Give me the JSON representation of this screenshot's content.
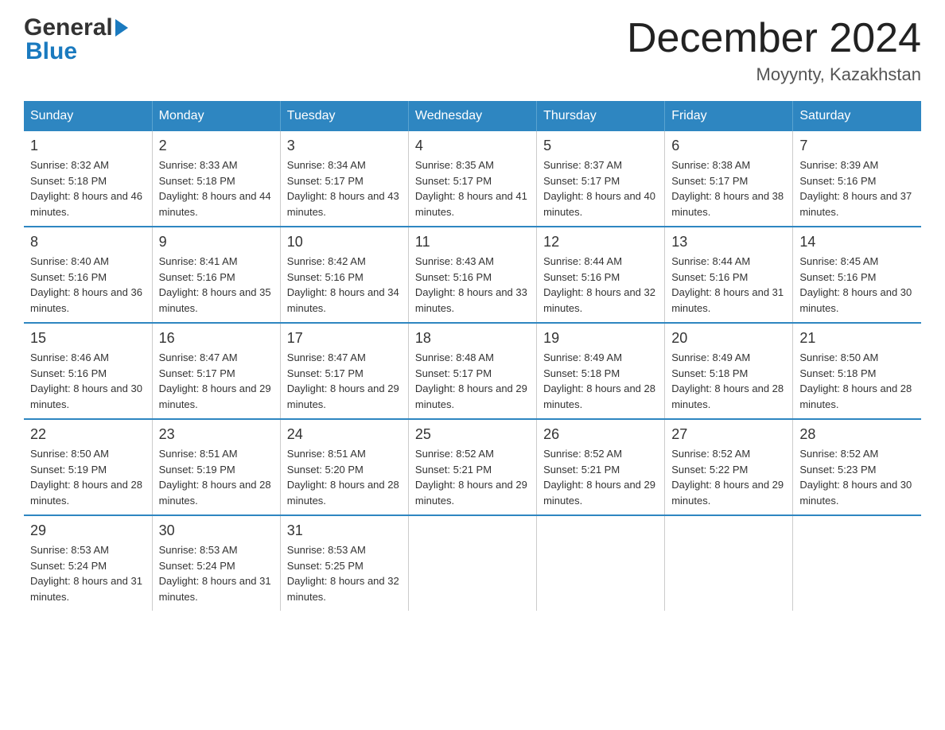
{
  "logo": {
    "text_general": "General",
    "text_blue": "Blue"
  },
  "header": {
    "month_title": "December 2024",
    "location": "Moyynty, Kazakhstan"
  },
  "days_of_week": [
    "Sunday",
    "Monday",
    "Tuesday",
    "Wednesday",
    "Thursday",
    "Friday",
    "Saturday"
  ],
  "weeks": [
    [
      {
        "day": "1",
        "sunrise": "Sunrise: 8:32 AM",
        "sunset": "Sunset: 5:18 PM",
        "daylight": "Daylight: 8 hours and 46 minutes."
      },
      {
        "day": "2",
        "sunrise": "Sunrise: 8:33 AM",
        "sunset": "Sunset: 5:18 PM",
        "daylight": "Daylight: 8 hours and 44 minutes."
      },
      {
        "day": "3",
        "sunrise": "Sunrise: 8:34 AM",
        "sunset": "Sunset: 5:17 PM",
        "daylight": "Daylight: 8 hours and 43 minutes."
      },
      {
        "day": "4",
        "sunrise": "Sunrise: 8:35 AM",
        "sunset": "Sunset: 5:17 PM",
        "daylight": "Daylight: 8 hours and 41 minutes."
      },
      {
        "day": "5",
        "sunrise": "Sunrise: 8:37 AM",
        "sunset": "Sunset: 5:17 PM",
        "daylight": "Daylight: 8 hours and 40 minutes."
      },
      {
        "day": "6",
        "sunrise": "Sunrise: 8:38 AM",
        "sunset": "Sunset: 5:17 PM",
        "daylight": "Daylight: 8 hours and 38 minutes."
      },
      {
        "day": "7",
        "sunrise": "Sunrise: 8:39 AM",
        "sunset": "Sunset: 5:16 PM",
        "daylight": "Daylight: 8 hours and 37 minutes."
      }
    ],
    [
      {
        "day": "8",
        "sunrise": "Sunrise: 8:40 AM",
        "sunset": "Sunset: 5:16 PM",
        "daylight": "Daylight: 8 hours and 36 minutes."
      },
      {
        "day": "9",
        "sunrise": "Sunrise: 8:41 AM",
        "sunset": "Sunset: 5:16 PM",
        "daylight": "Daylight: 8 hours and 35 minutes."
      },
      {
        "day": "10",
        "sunrise": "Sunrise: 8:42 AM",
        "sunset": "Sunset: 5:16 PM",
        "daylight": "Daylight: 8 hours and 34 minutes."
      },
      {
        "day": "11",
        "sunrise": "Sunrise: 8:43 AM",
        "sunset": "Sunset: 5:16 PM",
        "daylight": "Daylight: 8 hours and 33 minutes."
      },
      {
        "day": "12",
        "sunrise": "Sunrise: 8:44 AM",
        "sunset": "Sunset: 5:16 PM",
        "daylight": "Daylight: 8 hours and 32 minutes."
      },
      {
        "day": "13",
        "sunrise": "Sunrise: 8:44 AM",
        "sunset": "Sunset: 5:16 PM",
        "daylight": "Daylight: 8 hours and 31 minutes."
      },
      {
        "day": "14",
        "sunrise": "Sunrise: 8:45 AM",
        "sunset": "Sunset: 5:16 PM",
        "daylight": "Daylight: 8 hours and 30 minutes."
      }
    ],
    [
      {
        "day": "15",
        "sunrise": "Sunrise: 8:46 AM",
        "sunset": "Sunset: 5:16 PM",
        "daylight": "Daylight: 8 hours and 30 minutes."
      },
      {
        "day": "16",
        "sunrise": "Sunrise: 8:47 AM",
        "sunset": "Sunset: 5:17 PM",
        "daylight": "Daylight: 8 hours and 29 minutes."
      },
      {
        "day": "17",
        "sunrise": "Sunrise: 8:47 AM",
        "sunset": "Sunset: 5:17 PM",
        "daylight": "Daylight: 8 hours and 29 minutes."
      },
      {
        "day": "18",
        "sunrise": "Sunrise: 8:48 AM",
        "sunset": "Sunset: 5:17 PM",
        "daylight": "Daylight: 8 hours and 29 minutes."
      },
      {
        "day": "19",
        "sunrise": "Sunrise: 8:49 AM",
        "sunset": "Sunset: 5:18 PM",
        "daylight": "Daylight: 8 hours and 28 minutes."
      },
      {
        "day": "20",
        "sunrise": "Sunrise: 8:49 AM",
        "sunset": "Sunset: 5:18 PM",
        "daylight": "Daylight: 8 hours and 28 minutes."
      },
      {
        "day": "21",
        "sunrise": "Sunrise: 8:50 AM",
        "sunset": "Sunset: 5:18 PM",
        "daylight": "Daylight: 8 hours and 28 minutes."
      }
    ],
    [
      {
        "day": "22",
        "sunrise": "Sunrise: 8:50 AM",
        "sunset": "Sunset: 5:19 PM",
        "daylight": "Daylight: 8 hours and 28 minutes."
      },
      {
        "day": "23",
        "sunrise": "Sunrise: 8:51 AM",
        "sunset": "Sunset: 5:19 PM",
        "daylight": "Daylight: 8 hours and 28 minutes."
      },
      {
        "day": "24",
        "sunrise": "Sunrise: 8:51 AM",
        "sunset": "Sunset: 5:20 PM",
        "daylight": "Daylight: 8 hours and 28 minutes."
      },
      {
        "day": "25",
        "sunrise": "Sunrise: 8:52 AM",
        "sunset": "Sunset: 5:21 PM",
        "daylight": "Daylight: 8 hours and 29 minutes."
      },
      {
        "day": "26",
        "sunrise": "Sunrise: 8:52 AM",
        "sunset": "Sunset: 5:21 PM",
        "daylight": "Daylight: 8 hours and 29 minutes."
      },
      {
        "day": "27",
        "sunrise": "Sunrise: 8:52 AM",
        "sunset": "Sunset: 5:22 PM",
        "daylight": "Daylight: 8 hours and 29 minutes."
      },
      {
        "day": "28",
        "sunrise": "Sunrise: 8:52 AM",
        "sunset": "Sunset: 5:23 PM",
        "daylight": "Daylight: 8 hours and 30 minutes."
      }
    ],
    [
      {
        "day": "29",
        "sunrise": "Sunrise: 8:53 AM",
        "sunset": "Sunset: 5:24 PM",
        "daylight": "Daylight: 8 hours and 31 minutes."
      },
      {
        "day": "30",
        "sunrise": "Sunrise: 8:53 AM",
        "sunset": "Sunset: 5:24 PM",
        "daylight": "Daylight: 8 hours and 31 minutes."
      },
      {
        "day": "31",
        "sunrise": "Sunrise: 8:53 AM",
        "sunset": "Sunset: 5:25 PM",
        "daylight": "Daylight: 8 hours and 32 minutes."
      },
      null,
      null,
      null,
      null
    ]
  ]
}
